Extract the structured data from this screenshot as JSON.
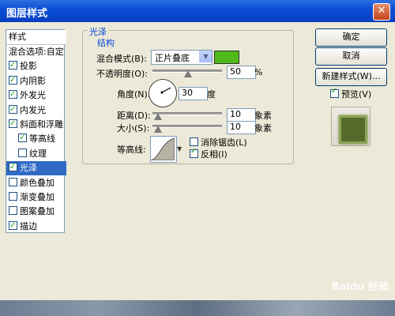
{
  "window": {
    "title": "图层样式",
    "close_glyph": "✕"
  },
  "style_list": {
    "header": "样式",
    "items": [
      {
        "label": "混合选项:自定",
        "checkbox": false,
        "checked": false,
        "selected": false,
        "indent": false
      },
      {
        "label": "投影",
        "checkbox": true,
        "checked": true,
        "selected": false,
        "indent": false
      },
      {
        "label": "内阴影",
        "checkbox": true,
        "checked": true,
        "selected": false,
        "indent": false
      },
      {
        "label": "外发光",
        "checkbox": true,
        "checked": true,
        "selected": false,
        "indent": false
      },
      {
        "label": "内发光",
        "checkbox": true,
        "checked": true,
        "selected": false,
        "indent": false
      },
      {
        "label": "斜面和浮雕",
        "checkbox": true,
        "checked": true,
        "selected": false,
        "indent": false
      },
      {
        "label": "等高线",
        "checkbox": true,
        "checked": true,
        "selected": false,
        "indent": true
      },
      {
        "label": "纹理",
        "checkbox": true,
        "checked": false,
        "selected": false,
        "indent": true
      },
      {
        "label": "光泽",
        "checkbox": true,
        "checked": true,
        "selected": true,
        "indent": false
      },
      {
        "label": "颜色叠加",
        "checkbox": true,
        "checked": false,
        "selected": false,
        "indent": false
      },
      {
        "label": "渐变叠加",
        "checkbox": true,
        "checked": false,
        "selected": false,
        "indent": false
      },
      {
        "label": "图案叠加",
        "checkbox": true,
        "checked": false,
        "selected": false,
        "indent": false
      },
      {
        "label": "描边",
        "checkbox": true,
        "checked": true,
        "selected": false,
        "indent": false
      }
    ]
  },
  "satin": {
    "section_title": "光泽",
    "subsection_title": "结构",
    "blend_mode_label": "混合模式(B):",
    "blend_mode_value": "正片叠底",
    "blend_color": "#4fb91a",
    "opacity_label": "不透明度(O):",
    "opacity_value": "50",
    "opacity_unit": "%",
    "angle_label": "角度(N):",
    "angle_value": "30",
    "angle_unit": "度",
    "distance_label": "距离(D):",
    "distance_value": "10",
    "distance_unit": "象素",
    "size_label": "大小(S):",
    "size_value": "10",
    "size_unit": "象素",
    "contour_label": "等高线:",
    "antialias_label": "消除锯齿(L)",
    "antialias_checked": false,
    "invert_label": "反相(I)",
    "invert_checked": true
  },
  "buttons": {
    "ok": "确定",
    "cancel": "取消",
    "new_style": "新建样式(W)..."
  },
  "preview": {
    "label": "预览(V)",
    "checked": true
  },
  "watermark": "Baidu 经验"
}
